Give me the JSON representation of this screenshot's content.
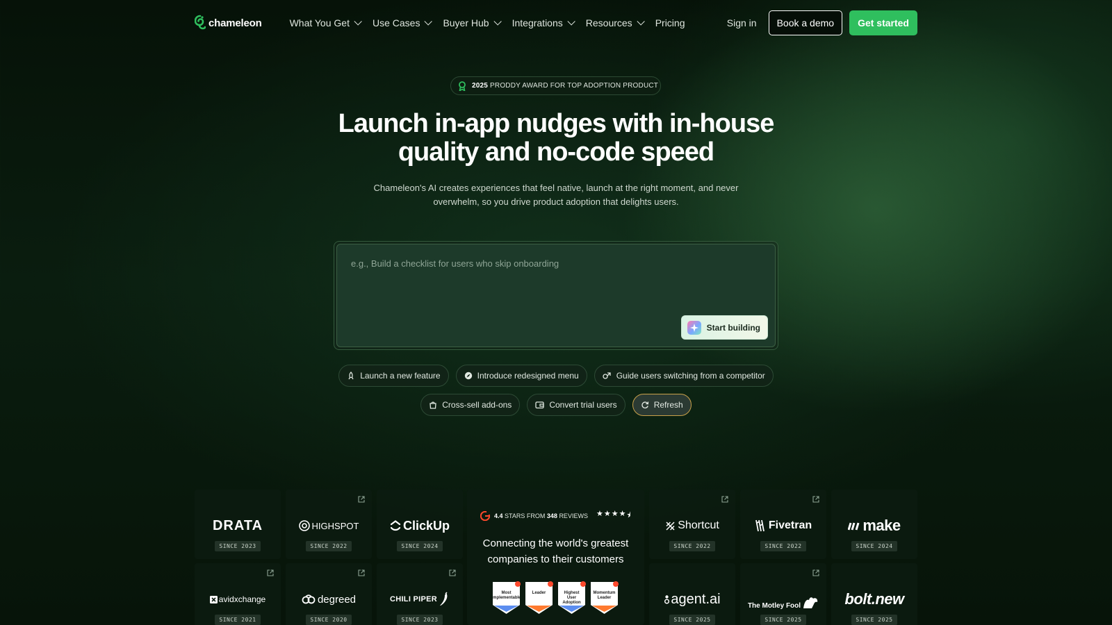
{
  "nav": {
    "logo_text": "chameleon",
    "links": [
      {
        "label": "What You Get",
        "dropdown": true
      },
      {
        "label": "Use Cases",
        "dropdown": true
      },
      {
        "label": "Buyer Hub",
        "dropdown": true
      },
      {
        "label": "Integrations",
        "dropdown": true
      },
      {
        "label": "Resources",
        "dropdown": true
      },
      {
        "label": "Pricing",
        "dropdown": false
      }
    ],
    "signin": "Sign in",
    "book_demo": "Book a demo",
    "get_started": "Get started"
  },
  "hero": {
    "award_year": "2025",
    "award_text": "PRODDY AWARD FOR TOP ADOPTION PRODUCT",
    "headline_line1": "Launch in-app nudges with in-house",
    "headline_line2": "quality and no-code speed",
    "subline_line1": "Chameleon's AI creates experiences that feel native, launch at the right moment, and never",
    "subline_line2": "overwhelm, so you drive product adoption that delights users."
  },
  "prompt": {
    "placeholder": "e.g., Build a checklist for users who skip onboarding",
    "value": "",
    "button_label": "Start building"
  },
  "chips": {
    "row1": [
      {
        "label": "Launch a new feature",
        "icon": "rocket-icon"
      },
      {
        "label": "Introduce redesigned menu",
        "icon": "compass-icon"
      },
      {
        "label": "Guide users switching from a competitor",
        "icon": "swap-icon"
      }
    ],
    "row2": [
      {
        "label": "Cross-sell add-ons",
        "icon": "bag-icon"
      },
      {
        "label": "Convert trial users",
        "icon": "wallet-icon"
      },
      {
        "label": "Refresh",
        "icon": "refresh-icon"
      }
    ]
  },
  "customers": {
    "row1": [
      {
        "name": "DRATA",
        "since": "SINCE 2023"
      },
      {
        "name": "HIGHSPOT",
        "since": "SINCE 2022"
      },
      {
        "name": "ClickUp",
        "since": "SINCE 2024"
      },
      {
        "name": "Shortcut",
        "since": "SINCE 2022"
      },
      {
        "name": "Fivetran",
        "since": "SINCE 2022"
      },
      {
        "name": "make",
        "since": "SINCE 2024"
      }
    ],
    "row2": [
      {
        "name": "avidxchange",
        "since": "SINCE 2021"
      },
      {
        "name": "degreed",
        "since": "SINCE 2020"
      },
      {
        "name": "CHILI PIPER",
        "since": "SINCE 2023"
      },
      {
        "name": "agent.ai",
        "since": "SINCE 2025"
      },
      {
        "name": "The Motley Fool",
        "since": "SINCE 2025"
      },
      {
        "name": "bolt.new",
        "since": "SINCE 2025"
      }
    ]
  },
  "g2": {
    "rating": "4.4",
    "stars_from": "STARS FROM",
    "review_count": "348",
    "reviews_word": "REVIEWS",
    "title_line1": "Connecting the world's greatest",
    "title_line2": "companies to their customers",
    "badges": [
      {
        "label": "Most Implementable",
        "stripe": "#5b8def"
      },
      {
        "label": "Leader",
        "stripe": "#ff7a2f"
      },
      {
        "label": "Highest User Adoption",
        "stripe": "#5b8def"
      },
      {
        "label": "Momentum Leader",
        "stripe": "#ff7a2f"
      }
    ]
  },
  "colors": {
    "accent_green": "#2fbf5e",
    "g2_red": "#ff492c"
  }
}
